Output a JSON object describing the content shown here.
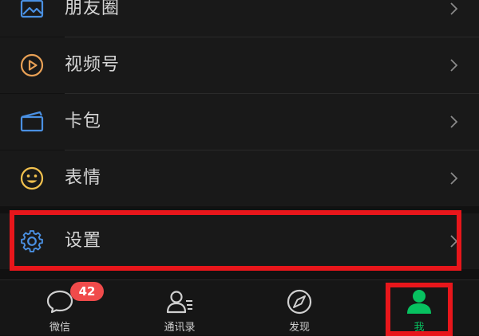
{
  "menu": {
    "items": [
      {
        "label": "朋友圈",
        "icon": "moments-icon"
      },
      {
        "label": "视频号",
        "icon": "channels-icon"
      },
      {
        "label": "卡包",
        "icon": "card-wallet-icon"
      },
      {
        "label": "表情",
        "icon": "sticker-icon"
      },
      {
        "label": "设置",
        "icon": "settings-icon"
      }
    ]
  },
  "tabbar": {
    "tabs": [
      {
        "label": "微信",
        "icon": "chat-icon",
        "badge": "42"
      },
      {
        "label": "通讯录",
        "icon": "contacts-icon"
      },
      {
        "label": "发现",
        "icon": "compass-icon"
      },
      {
        "label": "我",
        "icon": "me-icon",
        "active": true
      }
    ]
  },
  "colors": {
    "accent_green": "#07c160",
    "highlight_red": "#e8161b",
    "badge_red": "#f04b4b",
    "icon_blue": "#4a90e2",
    "icon_orange": "#e8a055",
    "icon_yellow": "#f2c14e"
  }
}
